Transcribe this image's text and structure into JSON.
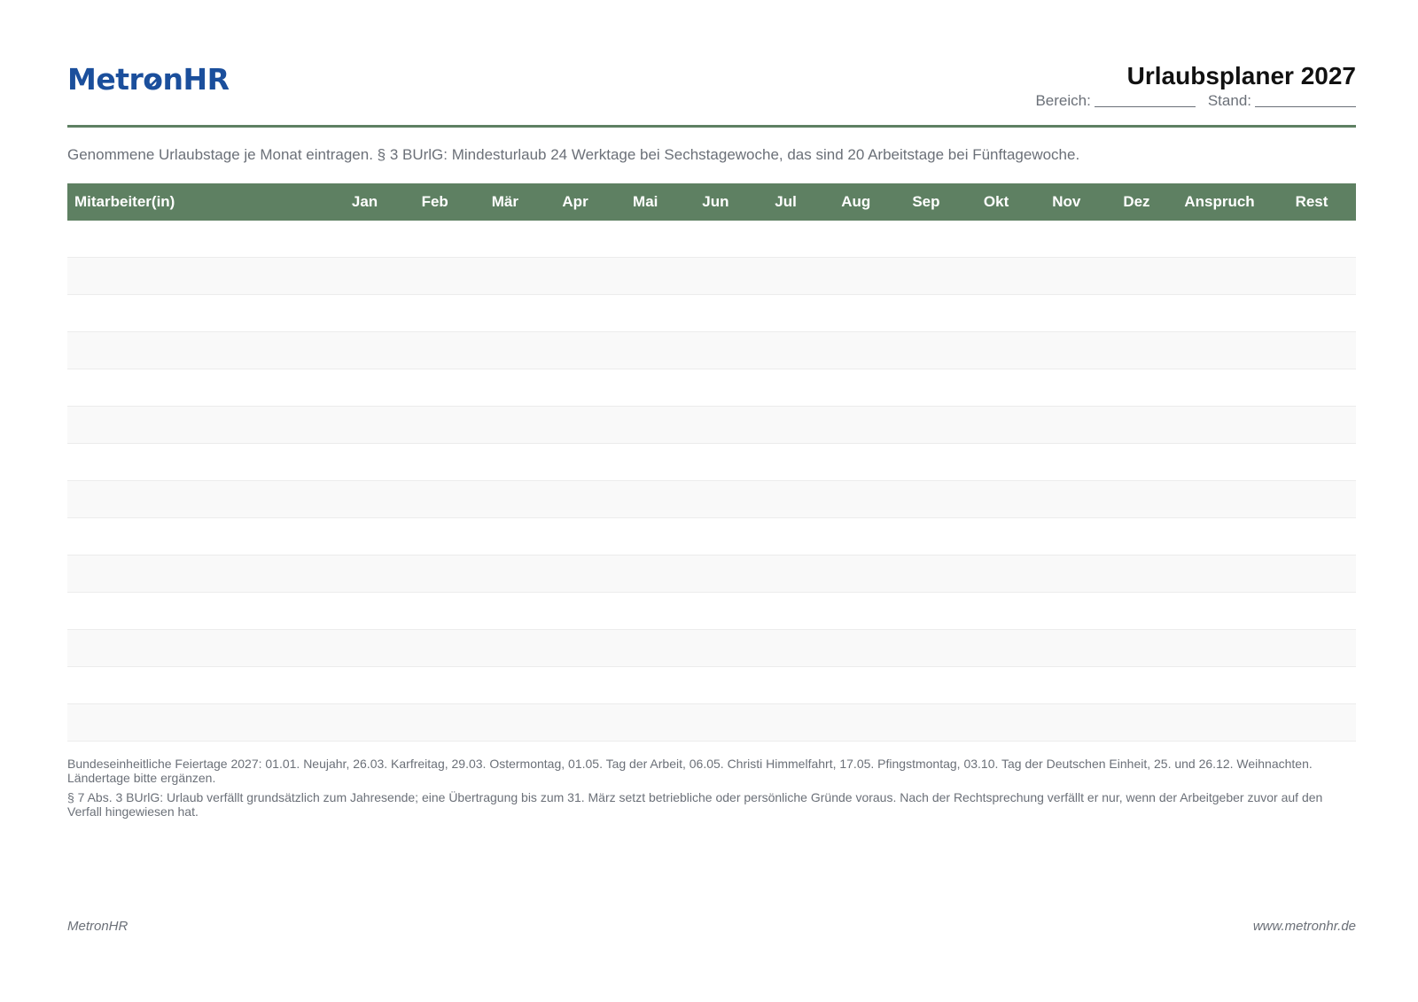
{
  "header": {
    "logo_prefix": "Metr",
    "logo_o": "o",
    "logo_suffix": "nHR",
    "title": "Urlaubsplaner 2027",
    "bereich_label": "Bereich:",
    "stand_label": "Stand:"
  },
  "intro": "Genommene Urlaubstage je Monat eintragen. § 3 BUrlG: Mindesturlaub 24 Werktage bei Sechstagewoche, das sind 20 Arbeitstage bei Fünftagewoche.",
  "table": {
    "columns": [
      "Mitarbeiter(in)",
      "Jan",
      "Feb",
      "Mär",
      "Apr",
      "Mai",
      "Jun",
      "Jul",
      "Aug",
      "Sep",
      "Okt",
      "Nov",
      "Dez",
      "Anspruch",
      "Rest"
    ],
    "empty_rows": 14
  },
  "notes": {
    "holidays": "Bundeseinheitliche Feiertage 2027: 01.01. Neujahr, 26.03. Karfreitag, 29.03. Ostermontag, 01.05. Tag der Arbeit, 06.05. Christi Himmelfahrt, 17.05. Pfingstmontag, 03.10. Tag der Deutschen Einheit, 25. und 26.12. Weihnachten. Ländertage bitte ergänzen.",
    "carryover": "§ 7 Abs. 3 BUrlG: Urlaub verfällt grundsätzlich zum Jahresende; eine Übertragung bis zum 31. März setzt betriebliche oder persönliche Gründe voraus. Nach der Rechtsprechung verfällt er nur, wenn der Arbeitgeber zuvor auf den Verfall hingewiesen hat."
  },
  "footer": {
    "left": "MetronHR",
    "right": "www.metronhr.de"
  },
  "colors": {
    "brand_blue": "#1b4f9c",
    "header_green": "#5e8062",
    "muted_text": "#6b7078"
  }
}
